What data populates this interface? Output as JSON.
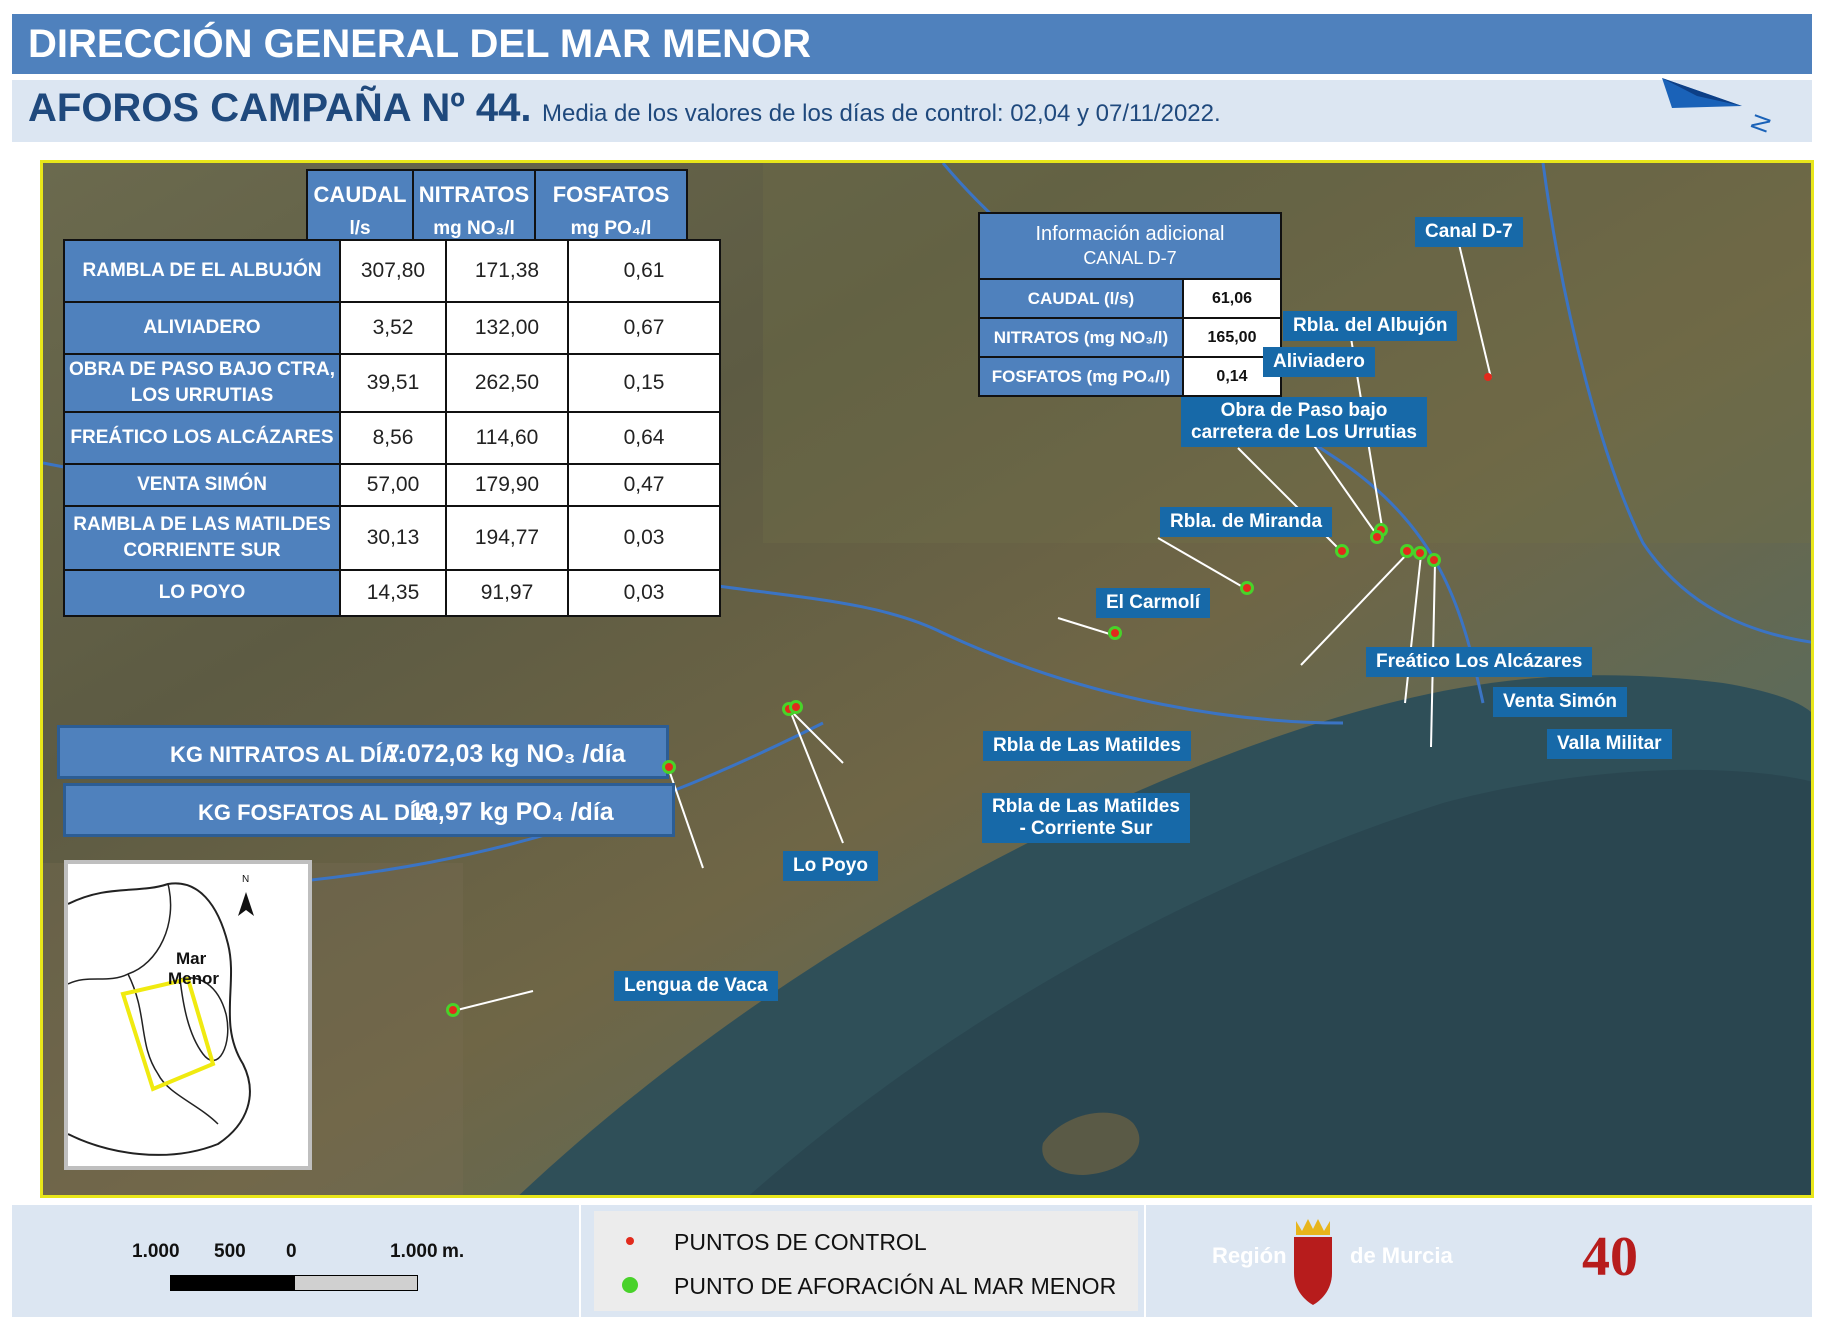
{
  "header": {
    "title": "DIRECCIÓN GENERAL DEL MAR MENOR",
    "campaign": "AFOROS CAMPAÑA  Nº 44.",
    "subtitle": "Media de los valores de los días de control: 02,04 y 07/11/2022."
  },
  "table": {
    "headers": [
      {
        "name": "CAUDAL",
        "unit": "l/s"
      },
      {
        "name": "NITRATOS",
        "unit": "mg NO₃/l"
      },
      {
        "name": "FOSFATOS",
        "unit": "mg PO₄/l"
      }
    ],
    "rows": [
      {
        "label": "RAMBLA DE EL ALBUJÓN",
        "caudal": "307,80",
        "nitratos": "171,38",
        "fosfatos": "0,61"
      },
      {
        "label": "ALIVIADERO",
        "caudal": "3,52",
        "nitratos": "132,00",
        "fosfatos": "0,67"
      },
      {
        "label": "OBRA DE PASO BAJO CTRA, LOS URRUTIAS",
        "caudal": "39,51",
        "nitratos": "262,50",
        "fosfatos": "0,15"
      },
      {
        "label": "FREÁTICO  LOS ALCÁZARES",
        "caudal": "8,56",
        "nitratos": "114,60",
        "fosfatos": "0,64"
      },
      {
        "label": "VENTA SIMÓN",
        "caudal": "57,00",
        "nitratos": "179,90",
        "fosfatos": "0,47"
      },
      {
        "label": "RAMBLA DE LAS MATILDES CORRIENTE SUR",
        "caudal": "30,13",
        "nitratos": "194,77",
        "fosfatos": "0,03"
      },
      {
        "label": "LO POYO",
        "caudal": "14,35",
        "nitratos": "91,97",
        "fosfatos": "0,03"
      }
    ]
  },
  "totals": {
    "nitratos_label": "KG NITRATOS AL DÍA:",
    "nitratos_value": "7.072,03 kg NO₃ /día",
    "fosfatos_label": "KG FOSFATOS AL DÍA:",
    "fosfatos_value": "19,97 kg PO₄ /día"
  },
  "info": {
    "title": "Información adicional",
    "subtitle": "CANAL D-7",
    "rows": [
      {
        "key": "CAUDAL (l/s)",
        "value": "61,06"
      },
      {
        "key": "NITRATOS (mg NO₃/l)",
        "value": "165,00"
      },
      {
        "key": "FOSFATOS (mg PO₄/l)",
        "value": "0,14"
      }
    ]
  },
  "inset": {
    "label_line1": "Mar",
    "label_line2": "Menor",
    "north": "N"
  },
  "map_labels": {
    "canal_d7": "Canal D-7",
    "rbla_albujon": "Rbla. del Albujón",
    "aliviadero": "Aliviadero",
    "obra_paso_1": "Obra de Paso bajo",
    "obra_paso_2": "carretera de Los Urrutias",
    "rbla_miranda": "Rbla. de Miranda",
    "el_carmoli": "El Carmolí",
    "freatico": "Freático Los Alcázares",
    "venta_simon": "Venta Simón",
    "valla_militar": "Valla Militar",
    "rbla_matildes": "Rbla de Las Matildes",
    "rbla_matildes_sur_1": "Rbla de Las Matildes",
    "rbla_matildes_sur_2": "- Corriente Sur",
    "lo_poyo": "Lo Poyo",
    "lengua_vaca": "Lengua de Vaca"
  },
  "north_arrow": "N",
  "scale": {
    "t1": "1.000",
    "t2": "500",
    "t3": "0",
    "t4": "1.000",
    "unit": "m."
  },
  "legend": {
    "control": "PUNTOS DE CONTROL",
    "aforo": "PUNTO DE AFORACIÓN AL MAR MENOR",
    "control_color": "#e22a1c",
    "aforo_color": "#48d22a"
  },
  "brand": {
    "region": "Región",
    "murcia": "de Murcia",
    "anniv": "40"
  }
}
